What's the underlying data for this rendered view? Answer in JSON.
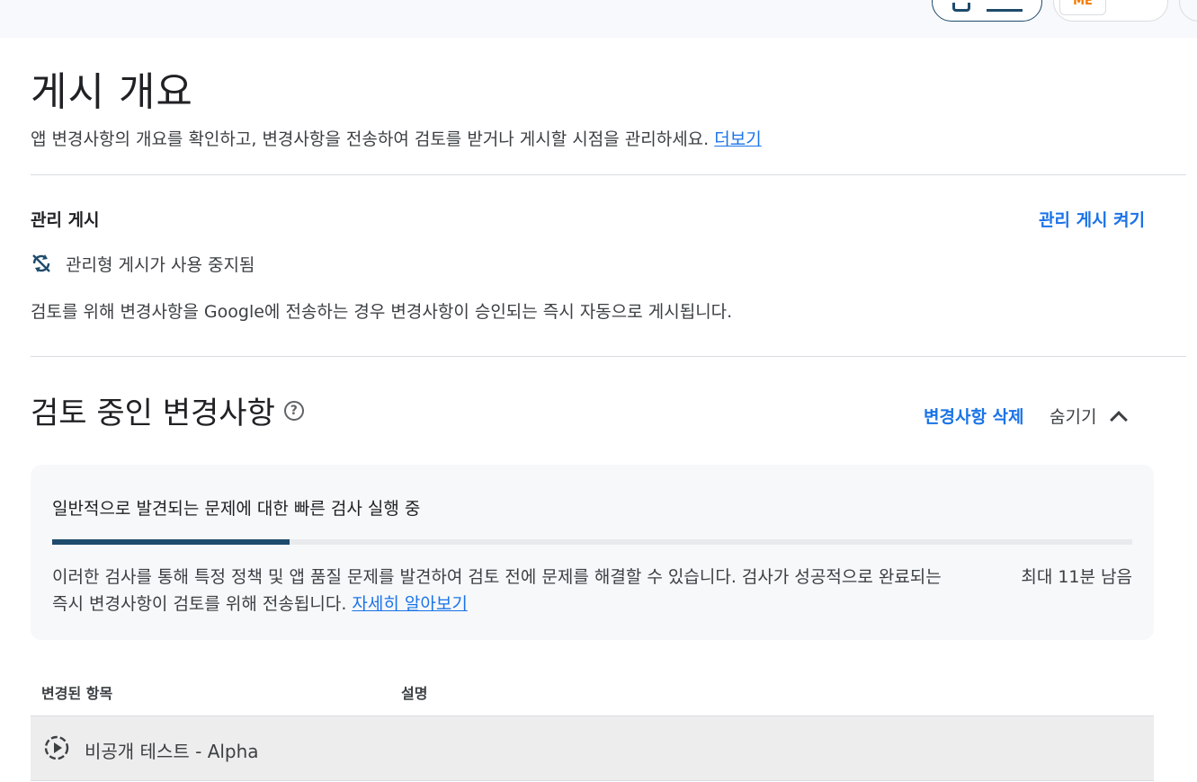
{
  "topbar": {
    "account_logo_text": "ME"
  },
  "page": {
    "title": "게시 개요",
    "subtitle": "앱 변경사항의 개요를 확인하고, 변경사항을 전송하여 검토를 받거나 게시할 시점을 관리하세요.",
    "more_link": "더보기"
  },
  "managed_publishing": {
    "label": "관리 게시",
    "turn_on_link": "관리 게시 켜기",
    "status_icon": "sync-disabled-icon",
    "status_text": "관리형 게시가 사용 중지됨",
    "description": "검토를 위해 변경사항을 Google에 전송하는 경우 변경사항이 승인되는 즉시 자동으로 게시됩니다."
  },
  "review_section": {
    "title": "검토 중인 변경사항",
    "help_icon": "help-circle-icon",
    "delete_link": "변경사항 삭제",
    "hide_label": "숨기기",
    "hide_icon": "chevron-up-icon"
  },
  "check_card": {
    "title": "일반적으로 발견되는 문제에 대한 빠른 검사 실행 중",
    "progress_fraction": 0.22,
    "text": "이러한 검사를 통해 특정 정책 및 앱 품질 문제를 발견하여 검토 전에 문제를 해결할 수 있습니다. 검사가 성공적으로 완료되는 즉시 변경사항이 검토를 위해 전송됩니다.",
    "learn_more_link": "자세히 알아보기",
    "time_left": "최대 11분 남음"
  },
  "table": {
    "headers": [
      "변경된 항목",
      "설명"
    ],
    "rows": [
      {
        "icon": "play-circle-dashed-icon",
        "item": "비공개 테스트 - Alpha"
      }
    ]
  },
  "colors": {
    "accent": "#1a73e8",
    "progress": "#1e4b6b",
    "card_bg": "#f7f8fa",
    "row_bg": "#ededed"
  }
}
